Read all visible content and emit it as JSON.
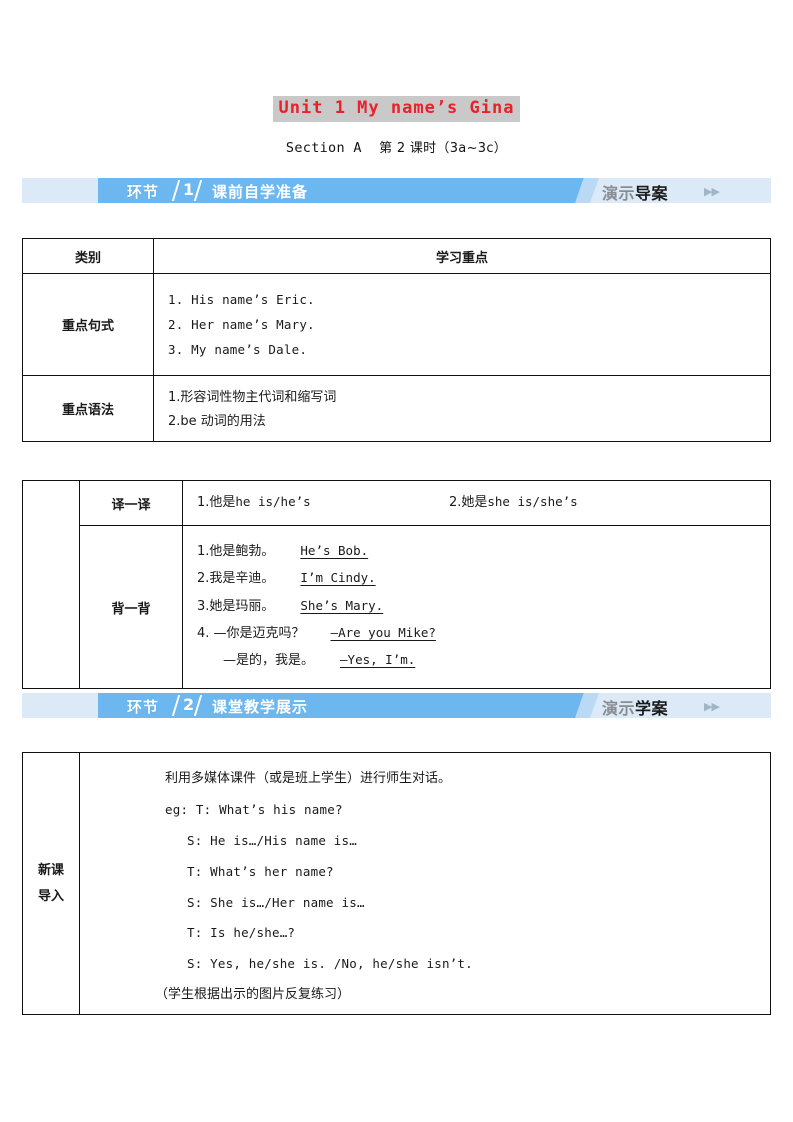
{
  "document": {
    "unit_title": "Unit 1 My name’s Gina",
    "section_line_prefix": "Section A",
    "section_line_cn": "第 2 课时（3a~3c）",
    "title_highlight_color": "#c9c9c9",
    "title_text_color": "#e8212a"
  },
  "banners": [
    {
      "label": "环节",
      "number": "1",
      "name": "课前自学准备",
      "right_label_ghost": "演示",
      "right_label_main": "导案",
      "arrows": "▶▶",
      "accent": "#6cb7ef",
      "light": "#dce9f7"
    },
    {
      "label": "环节",
      "number": "2",
      "name": "课堂教学展示",
      "right_label_ghost": "演示",
      "right_label_main": "学案",
      "arrows": "▶▶",
      "accent": "#6cb7ef",
      "light": "#dce9f7"
    }
  ],
  "table_focus": {
    "headers": [
      "类别",
      "学习重点"
    ],
    "rows": [
      {
        "label": "重点句式",
        "lines": [
          "1. His name’s Eric.",
          "2. Her name’s Mary.",
          "3. My name’s Dale."
        ]
      },
      {
        "label": "重点语法",
        "lines": [
          "1.形容词性物主代词和缩写词",
          "2.be 动词的用法"
        ]
      }
    ]
  },
  "table_practice": {
    "rows": [
      {
        "label": "译一译",
        "items": [
          {
            "cn": "1.他是",
            "en": "he is/he’s"
          },
          {
            "cn": "2.她是",
            "en": "she is/she’s"
          }
        ]
      },
      {
        "label": "背一背",
        "answers": [
          {
            "cn": "1.他是鲍勃。",
            "en": "He’s Bob."
          },
          {
            "cn": "2.我是辛迪。",
            "en": "I’m Cindy."
          },
          {
            "cn": "3.她是玛丽。",
            "en": "She’s Mary."
          },
          {
            "cn": "4.  —你是迈克吗？",
            "en": "—Are you Mike?"
          },
          {
            "cn": "—是的，我是。",
            "en": "—Yes, I’m."
          }
        ]
      }
    ]
  },
  "table_lesson": {
    "row_label_line1": "新课",
    "row_label_line2": "导入",
    "intro": "利用多媒体课件（或是班上学生）进行师生对话。",
    "dialogue": [
      {
        "text": "eg: T: What’s his name?",
        "indent": false
      },
      {
        "text": "S: He is…/His name is…",
        "indent": true
      },
      {
        "text": "T: What’s her name?",
        "indent": true
      },
      {
        "text": "S: She is…/Her name is…",
        "indent": true
      },
      {
        "text": "T: Is he/she…?",
        "indent": true
      },
      {
        "text": "S: Yes, he/she is. /No, he/she isn’t.",
        "indent": true
      }
    ],
    "footnote": "（学生根据出示的图片反复练习）"
  }
}
